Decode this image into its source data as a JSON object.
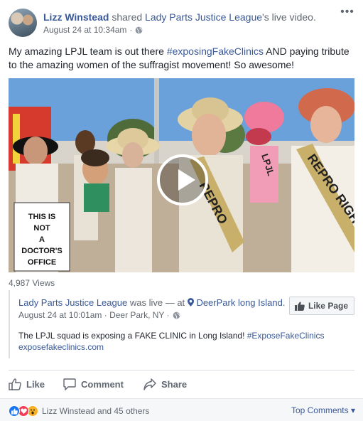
{
  "header": {
    "author": "Lizz Winstead",
    "shared_word": "shared",
    "page_name": "Lady Parts Justice League",
    "live_video": "'s live video.",
    "timestamp": "August 24 at 10:34am",
    "more_label": "•••"
  },
  "post_text": {
    "part1": "My amazing LPJL team is out there ",
    "hashtag": "#exposingFakeClinics",
    "part2": " AND paying tribute to the amazing women of the suffragist movement! So awesome!"
  },
  "video": {
    "sign_text": "THIS IS NOT A DOCTOR'S OFFICE",
    "sash_1": "REPRO",
    "sash_2": "REPRO RIGHTS",
    "sash_3": "LPJL",
    "views": "4,987 Views"
  },
  "shared_card": {
    "page_name": "Lady Parts Justice League",
    "was_live": "was live",
    "at_word": "— at",
    "location": "DeerPark long Island.",
    "date_place": "August 24 at 10:01am · Deer Park, NY ·",
    "like_page_label": "Like Page",
    "desc_text": "The LPJL squad is exposing a FAKE CLINIC in Long Island! ",
    "desc_hashtag": "#ExposeFakeClinics",
    "desc_site": "exposefakeclinics.com"
  },
  "actions": {
    "like": "Like",
    "comment": "Comment",
    "share": "Share"
  },
  "footer": {
    "reactions_text": "Lizz Winstead and 45 others",
    "top_comments": "Top Comments ▾"
  },
  "colors": {
    "link": "#385898",
    "secondary_text": "#616770",
    "like_blue": "#1877f2",
    "love_red": "#f33e58",
    "wow_yellow": "#f7b125"
  }
}
